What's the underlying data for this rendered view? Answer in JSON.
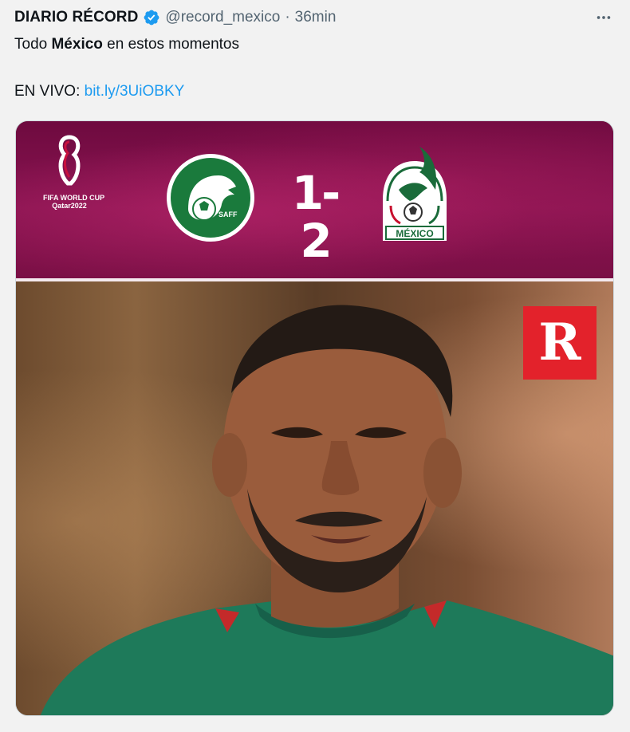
{
  "tweet": {
    "author_name": "DIARIO RÉCORD",
    "handle": "@record_mexico",
    "separator": "·",
    "time": "36min",
    "text_part1": "Todo ",
    "text_bold": "México",
    "text_part2": " en estos momentos",
    "live_label": "EN VIVO: ",
    "link_text": "bit.ly/3UiOBKY"
  },
  "media": {
    "tournament_line1": "FIFA WORLD CUP",
    "tournament_line2": "Qatar2022",
    "home_team_badge": "SAFF",
    "away_team_badge": "MÉXICO",
    "score": "1-2",
    "brand_letter": "R"
  },
  "colors": {
    "accent_link": "#1d9bf0",
    "verified": "#1d9bf0",
    "scoreboard_bg": "#7a0f45",
    "brand_red": "#e3222b"
  },
  "icons": [
    "verified-badge-icon",
    "more-options-icon"
  ]
}
